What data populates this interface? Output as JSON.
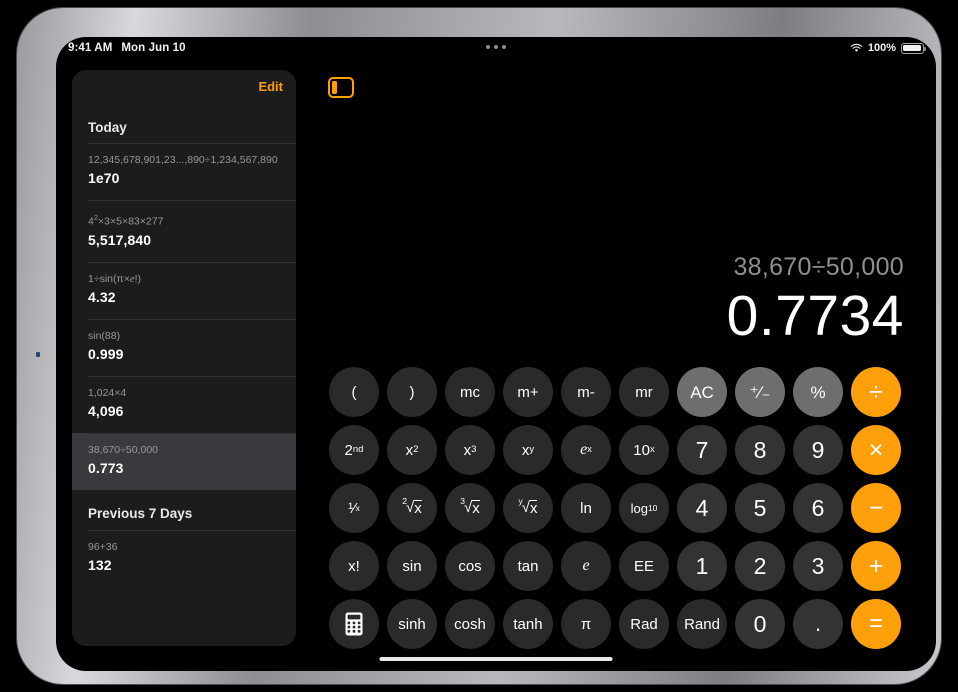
{
  "status_bar": {
    "time": "9:41 AM",
    "date": "Mon Jun 10",
    "battery_percent": "100%",
    "wifi_icon": "wifi-icon",
    "battery_icon": "battery-full-icon"
  },
  "sidebar": {
    "edit_label": "Edit",
    "toggle_icon": "sidebar-toggle-icon",
    "sections": [
      {
        "title": "Today",
        "rows": [
          {
            "expression": "12,345,678,901,23...,890÷1,234,567,890",
            "result": "1e70",
            "selected": false
          },
          {
            "expression": "4²×3×5×83×277",
            "result": "5,517,840",
            "selected": false
          },
          {
            "expression": "1÷sin(π×e!)",
            "result": "4.32",
            "selected": false
          },
          {
            "expression": "sin(88)",
            "result": "0.999",
            "selected": false
          },
          {
            "expression": "1,024×4",
            "result": "4,096",
            "selected": false
          },
          {
            "expression": "38,670÷50,000",
            "result": "0.773",
            "selected": true
          }
        ]
      },
      {
        "title": "Previous 7 Days",
        "rows": [
          {
            "expression": "96+36",
            "result": "132",
            "selected": false
          }
        ]
      }
    ]
  },
  "multitask_icon": "multitask-dots-icon",
  "display": {
    "expression": "38,670÷50,000",
    "result": "0.7734"
  },
  "keypad": {
    "rows": [
      [
        {
          "label": "(",
          "kind": "fn"
        },
        {
          "label": ")",
          "kind": "fn"
        },
        {
          "label": "mc",
          "kind": "fn"
        },
        {
          "label": "m+",
          "kind": "fn"
        },
        {
          "label": "m-",
          "kind": "fn"
        },
        {
          "label": "mr",
          "kind": "fn"
        },
        {
          "label": "AC",
          "kind": "util"
        },
        {
          "label": "+/-",
          "kind": "util"
        },
        {
          "label": "%",
          "kind": "util"
        },
        {
          "label": "÷",
          "kind": "op"
        }
      ],
      [
        {
          "label": "2nd",
          "kind": "fn"
        },
        {
          "label": "x²",
          "kind": "fn"
        },
        {
          "label": "x³",
          "kind": "fn"
        },
        {
          "label": "xʸ",
          "kind": "fn"
        },
        {
          "label": "eˣ",
          "kind": "fn"
        },
        {
          "label": "10ˣ",
          "kind": "fn"
        },
        {
          "label": "7",
          "kind": "num"
        },
        {
          "label": "8",
          "kind": "num"
        },
        {
          "label": "9",
          "kind": "num"
        },
        {
          "label": "×",
          "kind": "op"
        }
      ],
      [
        {
          "label": "1/x",
          "kind": "fn"
        },
        {
          "label": "²√x",
          "kind": "fn"
        },
        {
          "label": "³√x",
          "kind": "fn"
        },
        {
          "label": "ʸ√x",
          "kind": "fn"
        },
        {
          "label": "ln",
          "kind": "fn"
        },
        {
          "label": "log10",
          "kind": "fn"
        },
        {
          "label": "4",
          "kind": "num"
        },
        {
          "label": "5",
          "kind": "num"
        },
        {
          "label": "6",
          "kind": "num"
        },
        {
          "label": "−",
          "kind": "op"
        }
      ],
      [
        {
          "label": "x!",
          "kind": "fn"
        },
        {
          "label": "sin",
          "kind": "fn"
        },
        {
          "label": "cos",
          "kind": "fn"
        },
        {
          "label": "tan",
          "kind": "fn"
        },
        {
          "label": "e",
          "kind": "fn"
        },
        {
          "label": "EE",
          "kind": "fn"
        },
        {
          "label": "1",
          "kind": "num"
        },
        {
          "label": "2",
          "kind": "num"
        },
        {
          "label": "3",
          "kind": "num"
        },
        {
          "label": "+",
          "kind": "op"
        }
      ],
      [
        {
          "label": "calculator-icon",
          "kind": "fn"
        },
        {
          "label": "sinh",
          "kind": "fn"
        },
        {
          "label": "cosh",
          "kind": "fn"
        },
        {
          "label": "tanh",
          "kind": "fn"
        },
        {
          "label": "π",
          "kind": "fn"
        },
        {
          "label": "Rad",
          "kind": "fn"
        },
        {
          "label": "Rand",
          "kind": "fn"
        },
        {
          "label": "0",
          "kind": "num"
        },
        {
          "label": ".",
          "kind": "num"
        },
        {
          "label": "=",
          "kind": "op"
        }
      ]
    ]
  },
  "colors": {
    "accent_orange": "#ff9f0a",
    "key_function": "#2a2a2c",
    "key_number": "#333335",
    "key_utility": "#6e6e70",
    "sidebar_bg": "#1c1c1e",
    "row_selected": "#3a3a3e"
  },
  "home_indicator": "home-indicator"
}
